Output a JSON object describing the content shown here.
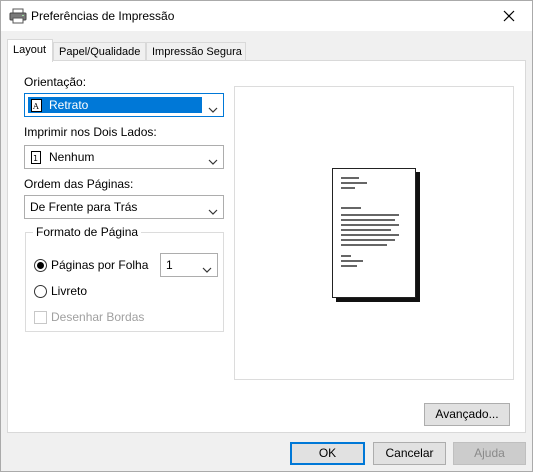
{
  "window": {
    "title": "Preferências de Impressão",
    "icons": {
      "app": "printer-icon",
      "close": "close-icon"
    }
  },
  "tabs": [
    {
      "label": "Layout",
      "active": true
    },
    {
      "label": "Papel/Qualidade",
      "active": false
    },
    {
      "label": "Impressão Segura",
      "active": false
    }
  ],
  "layout": {
    "orientation": {
      "label": "Orientação:",
      "value": "Retrato",
      "icon": "portrait-page-icon"
    },
    "duplex": {
      "label": "Imprimir nos Dois Lados:",
      "value": "Nenhum",
      "icon": "single-sided-page-icon"
    },
    "page_order": {
      "label": "Ordem das Páginas:",
      "value": "De Frente para Trás"
    },
    "page_format": {
      "title": "Formato de Página",
      "pages_per_sheet": {
        "label": "Páginas por Folha",
        "selected": true,
        "value": "1"
      },
      "booklet": {
        "label": "Livreto",
        "selected": false
      },
      "draw_borders": {
        "label": "Desenhar Bordas",
        "checked": false,
        "enabled": false
      }
    },
    "advanced_button": "Avançado..."
  },
  "footer": {
    "ok": "OK",
    "cancel": "Cancelar",
    "help": "Ajuda"
  },
  "colors": {
    "accent": "#0078d7",
    "window_bg": "#f0f0f0",
    "disabled_text": "#a0a0a0"
  }
}
